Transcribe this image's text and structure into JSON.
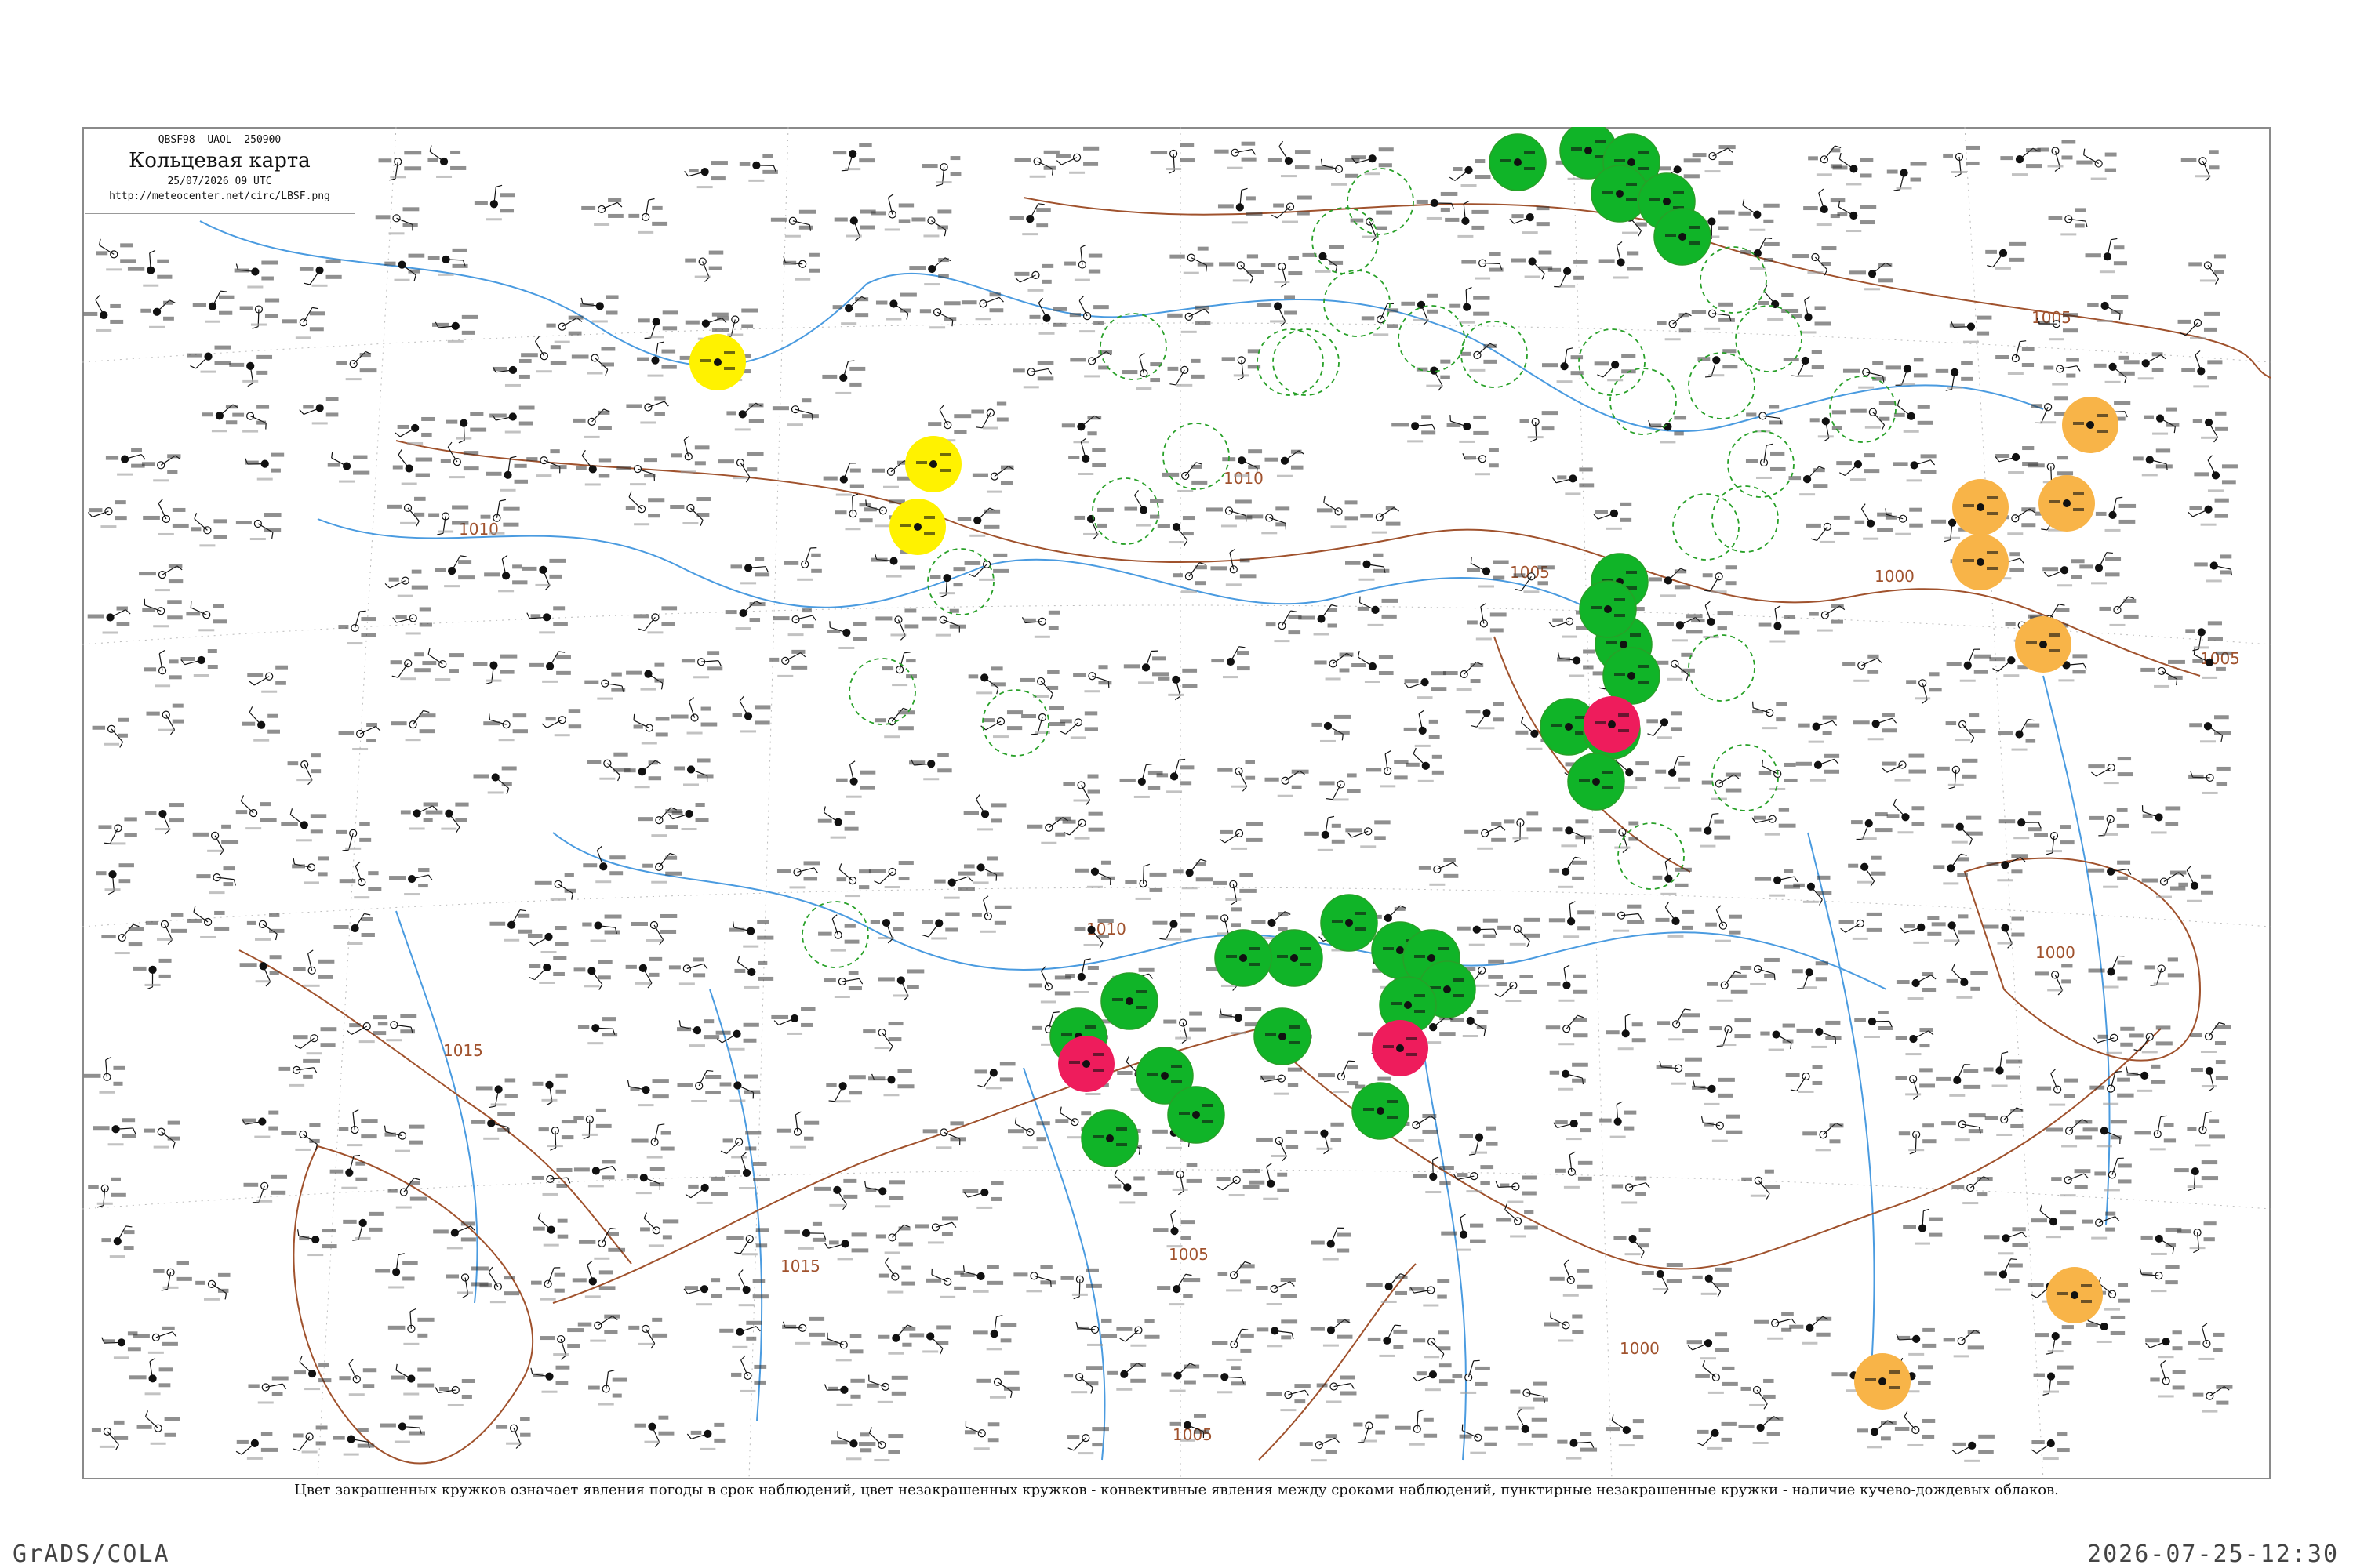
{
  "title_box": {
    "code": "QBSF98  UAOL  250900",
    "title": "Кольцевая карта",
    "date": "25/07/2026 09 UTC",
    "url": "http://meteocenter.net/circ/LBSF.png"
  },
  "caption": "Цвет закрашенных кружков означает явления погоды в срок наблюдений, цвет незакрашенных кружков - конвективные явления между сроками наблюдений, пунктирные незакрашенные кружки - наличие кучево-дождевых облаков.",
  "footer": {
    "left": "GrADS/COLA",
    "right": "2026-07-25-12:30"
  },
  "isobar_labels": [
    "1005",
    "1010",
    "1005",
    "1005",
    "1000",
    "1005",
    "1010",
    "1010",
    "1015",
    "1015",
    "1000",
    "1000",
    "1005"
  ],
  "colors": {
    "green": "#10b428",
    "yellow": "#fff200",
    "orange": "#f8b448",
    "red": "#ee1c5c",
    "dashed": "#28a028",
    "isobar": "#a0522d",
    "river": "#4a9be0"
  }
}
